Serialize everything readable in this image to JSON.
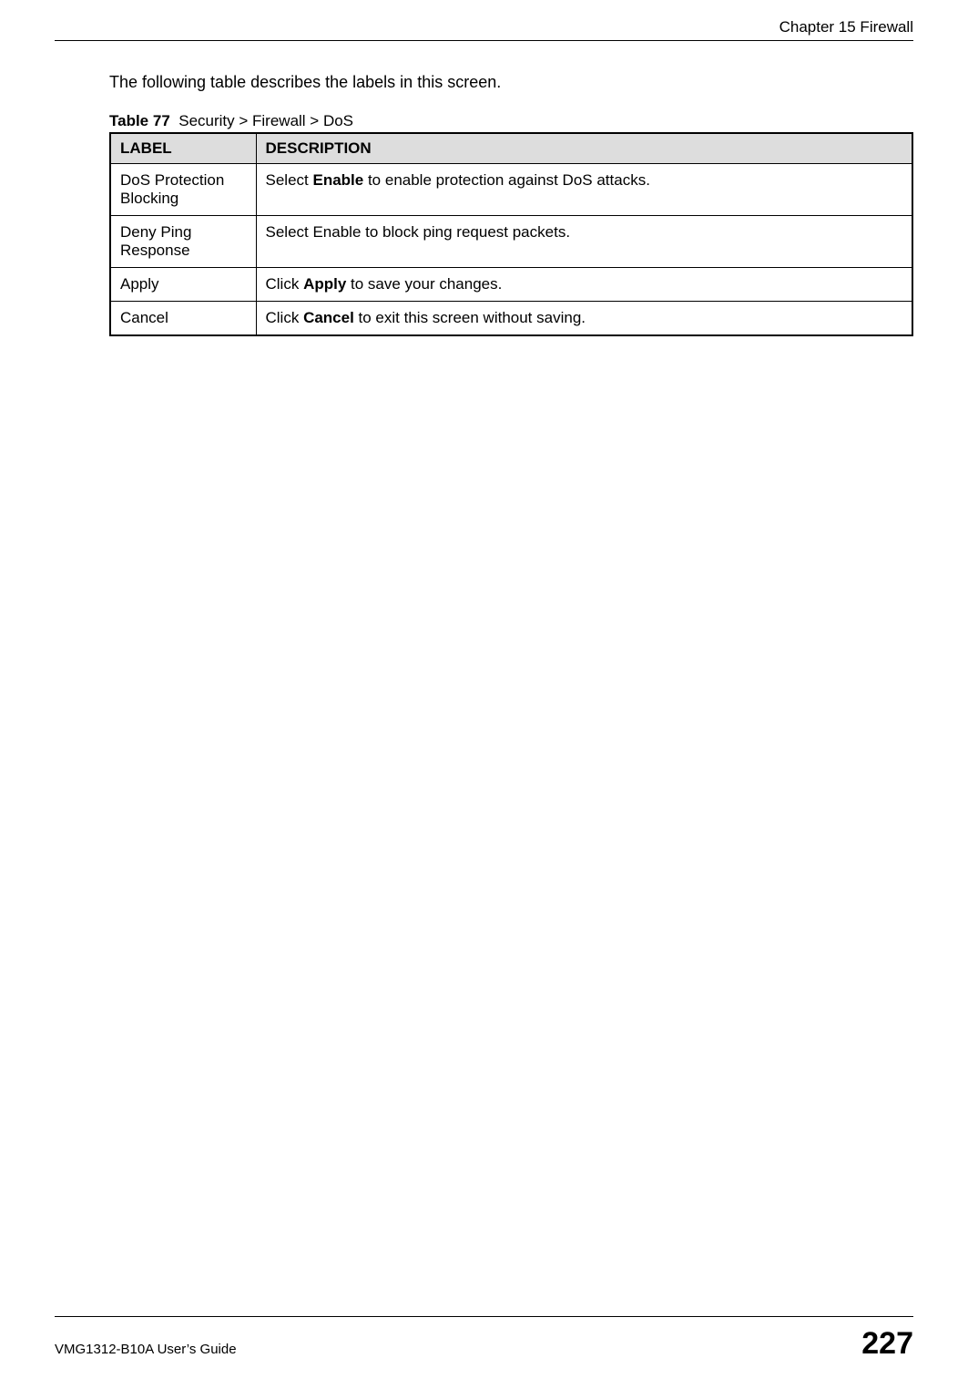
{
  "header": {
    "chapter": "Chapter 15 Firewall"
  },
  "intro": "The following table describes the labels in this screen.",
  "table": {
    "caption_prefix": "Table 77",
    "caption_text": "Security > Firewall > DoS",
    "headers": {
      "label": "LABEL",
      "description": "DESCRIPTION"
    },
    "rows": [
      {
        "label": "DoS Protection Blocking",
        "desc_pre": "Select ",
        "desc_bold": "Enable",
        "desc_post": " to enable protection against DoS attacks."
      },
      {
        "label": "Deny Ping Response",
        "desc_pre": "Select Enable to block ping request packets.",
        "desc_bold": "",
        "desc_post": ""
      },
      {
        "label": "Apply",
        "desc_pre": "Click ",
        "desc_bold": "Apply",
        "desc_post": " to save your changes."
      },
      {
        "label": "Cancel",
        "desc_pre": "Click ",
        "desc_bold": "Cancel",
        "desc_post": " to exit this screen without saving."
      }
    ]
  },
  "footer": {
    "guide": "VMG1312-B10A User’s Guide",
    "page": "227"
  }
}
